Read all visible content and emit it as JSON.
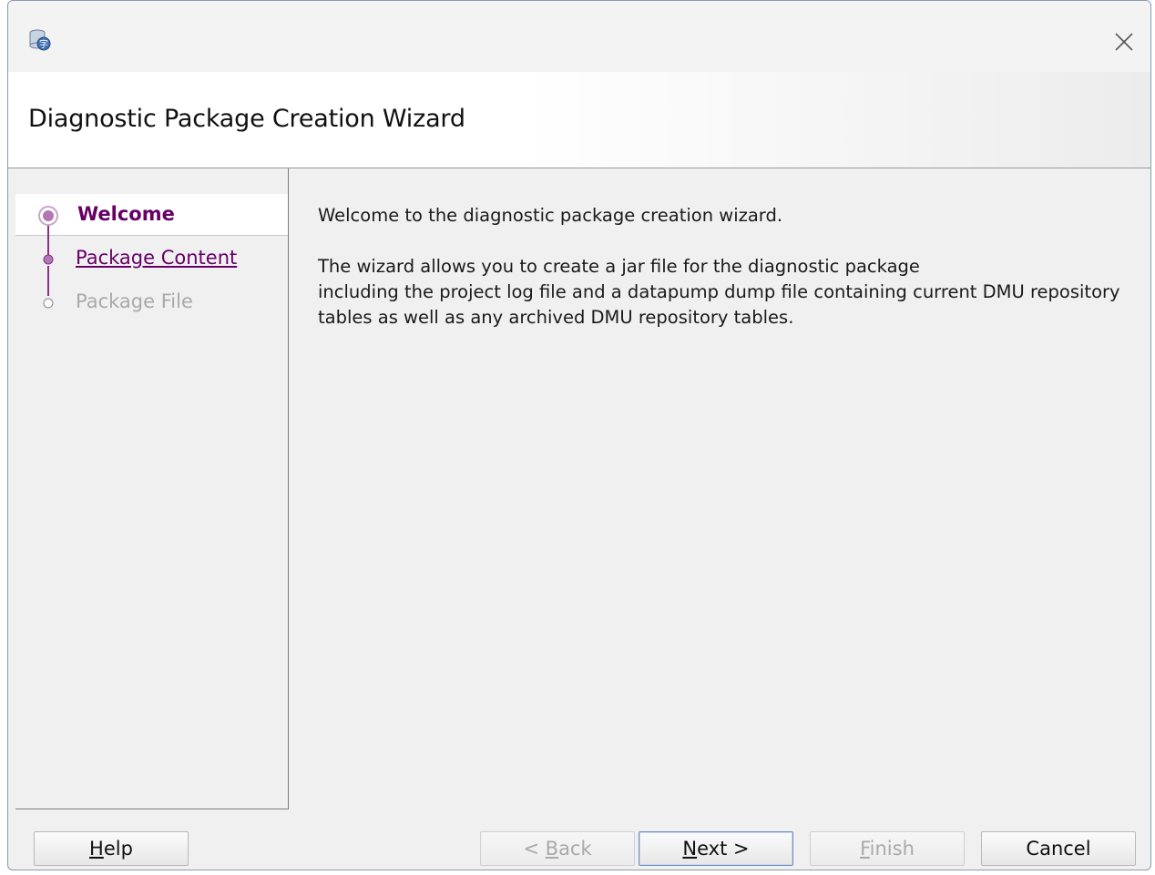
{
  "window": {
    "app_icon": "database-charset-icon",
    "close_icon": "close-icon"
  },
  "header": {
    "title": "Diagnostic Package Creation Wizard"
  },
  "steps": [
    {
      "label": "Welcome",
      "state": "current"
    },
    {
      "label": "Package Content",
      "state": "link"
    },
    {
      "label": "Package File",
      "state": "disabled"
    }
  ],
  "content": {
    "intro": "Welcome to the diagnostic package creation wizard.",
    "line1": "The wizard allows you to create a jar file for the diagnostic package",
    "line2": "including the project log file and a datapump dump file containing current DMU repository",
    "line3": "tables as well as any archived DMU repository tables."
  },
  "buttons": {
    "help": {
      "mnemonic": "H",
      "rest": "elp"
    },
    "back": {
      "prefix": "< ",
      "mnemonic": "B",
      "rest": "ack"
    },
    "next": {
      "mnemonic": "N",
      "rest": "ext >"
    },
    "finish": {
      "mnemonic": "F",
      "rest": "inish"
    },
    "cancel": {
      "label": "Cancel"
    }
  },
  "colors": {
    "accent": "#660066",
    "disabled_text": "#a9a9a9",
    "panel_bg": "#f0f0f0"
  }
}
